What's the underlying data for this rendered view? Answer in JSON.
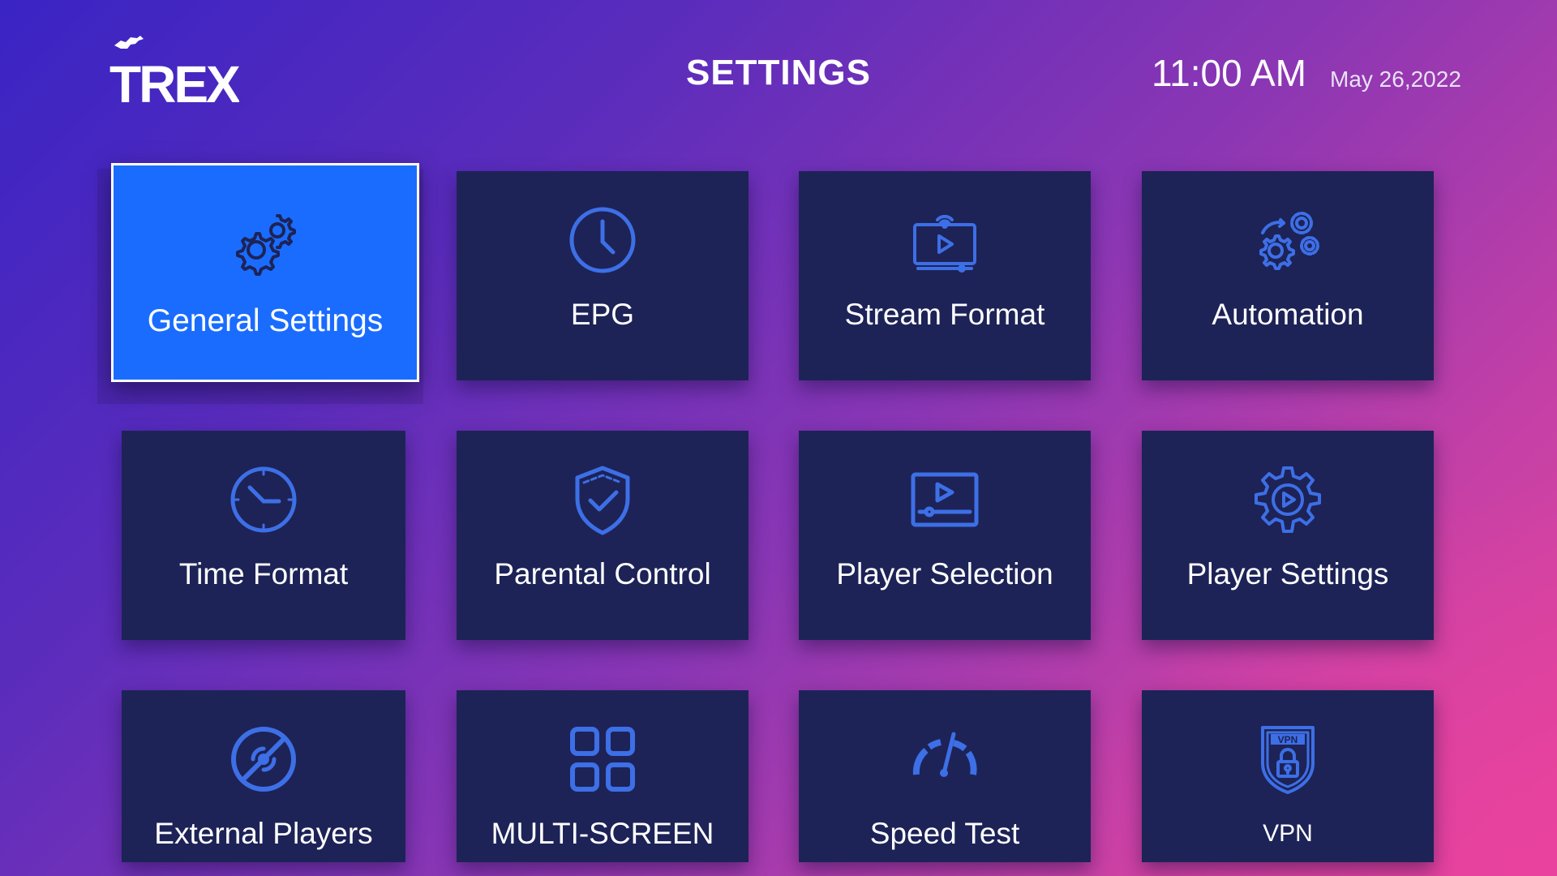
{
  "header": {
    "logo_text": "TREX",
    "title": "SETTINGS",
    "time": "11:00 AM",
    "date": "May 26,2022"
  },
  "tiles": [
    {
      "label": "General Settings",
      "icon": "gears-icon",
      "selected": true
    },
    {
      "label": "EPG",
      "icon": "clock-icon"
    },
    {
      "label": "Stream Format",
      "icon": "tv-stream-icon"
    },
    {
      "label": "Automation",
      "icon": "automation-gears-icon"
    },
    {
      "label": "Time Format",
      "icon": "time-clock-icon"
    },
    {
      "label": "Parental Control",
      "icon": "shield-check-icon"
    },
    {
      "label": "Player Selection",
      "icon": "player-screen-icon"
    },
    {
      "label": "Player Settings",
      "icon": "gear-play-icon"
    },
    {
      "label": "External Players",
      "icon": "external-player-icon"
    },
    {
      "label": "MULTI-SCREEN",
      "icon": "grid-icon"
    },
    {
      "label": "Speed Test",
      "icon": "speedometer-icon"
    },
    {
      "label": "VPN",
      "icon": "vpn-shield-icon"
    }
  ],
  "colors": {
    "tile_bg": "#1d2357",
    "tile_selected_bg": "#1a6cff",
    "icon_color": "#3d6fe6",
    "text": "#ffffff"
  }
}
